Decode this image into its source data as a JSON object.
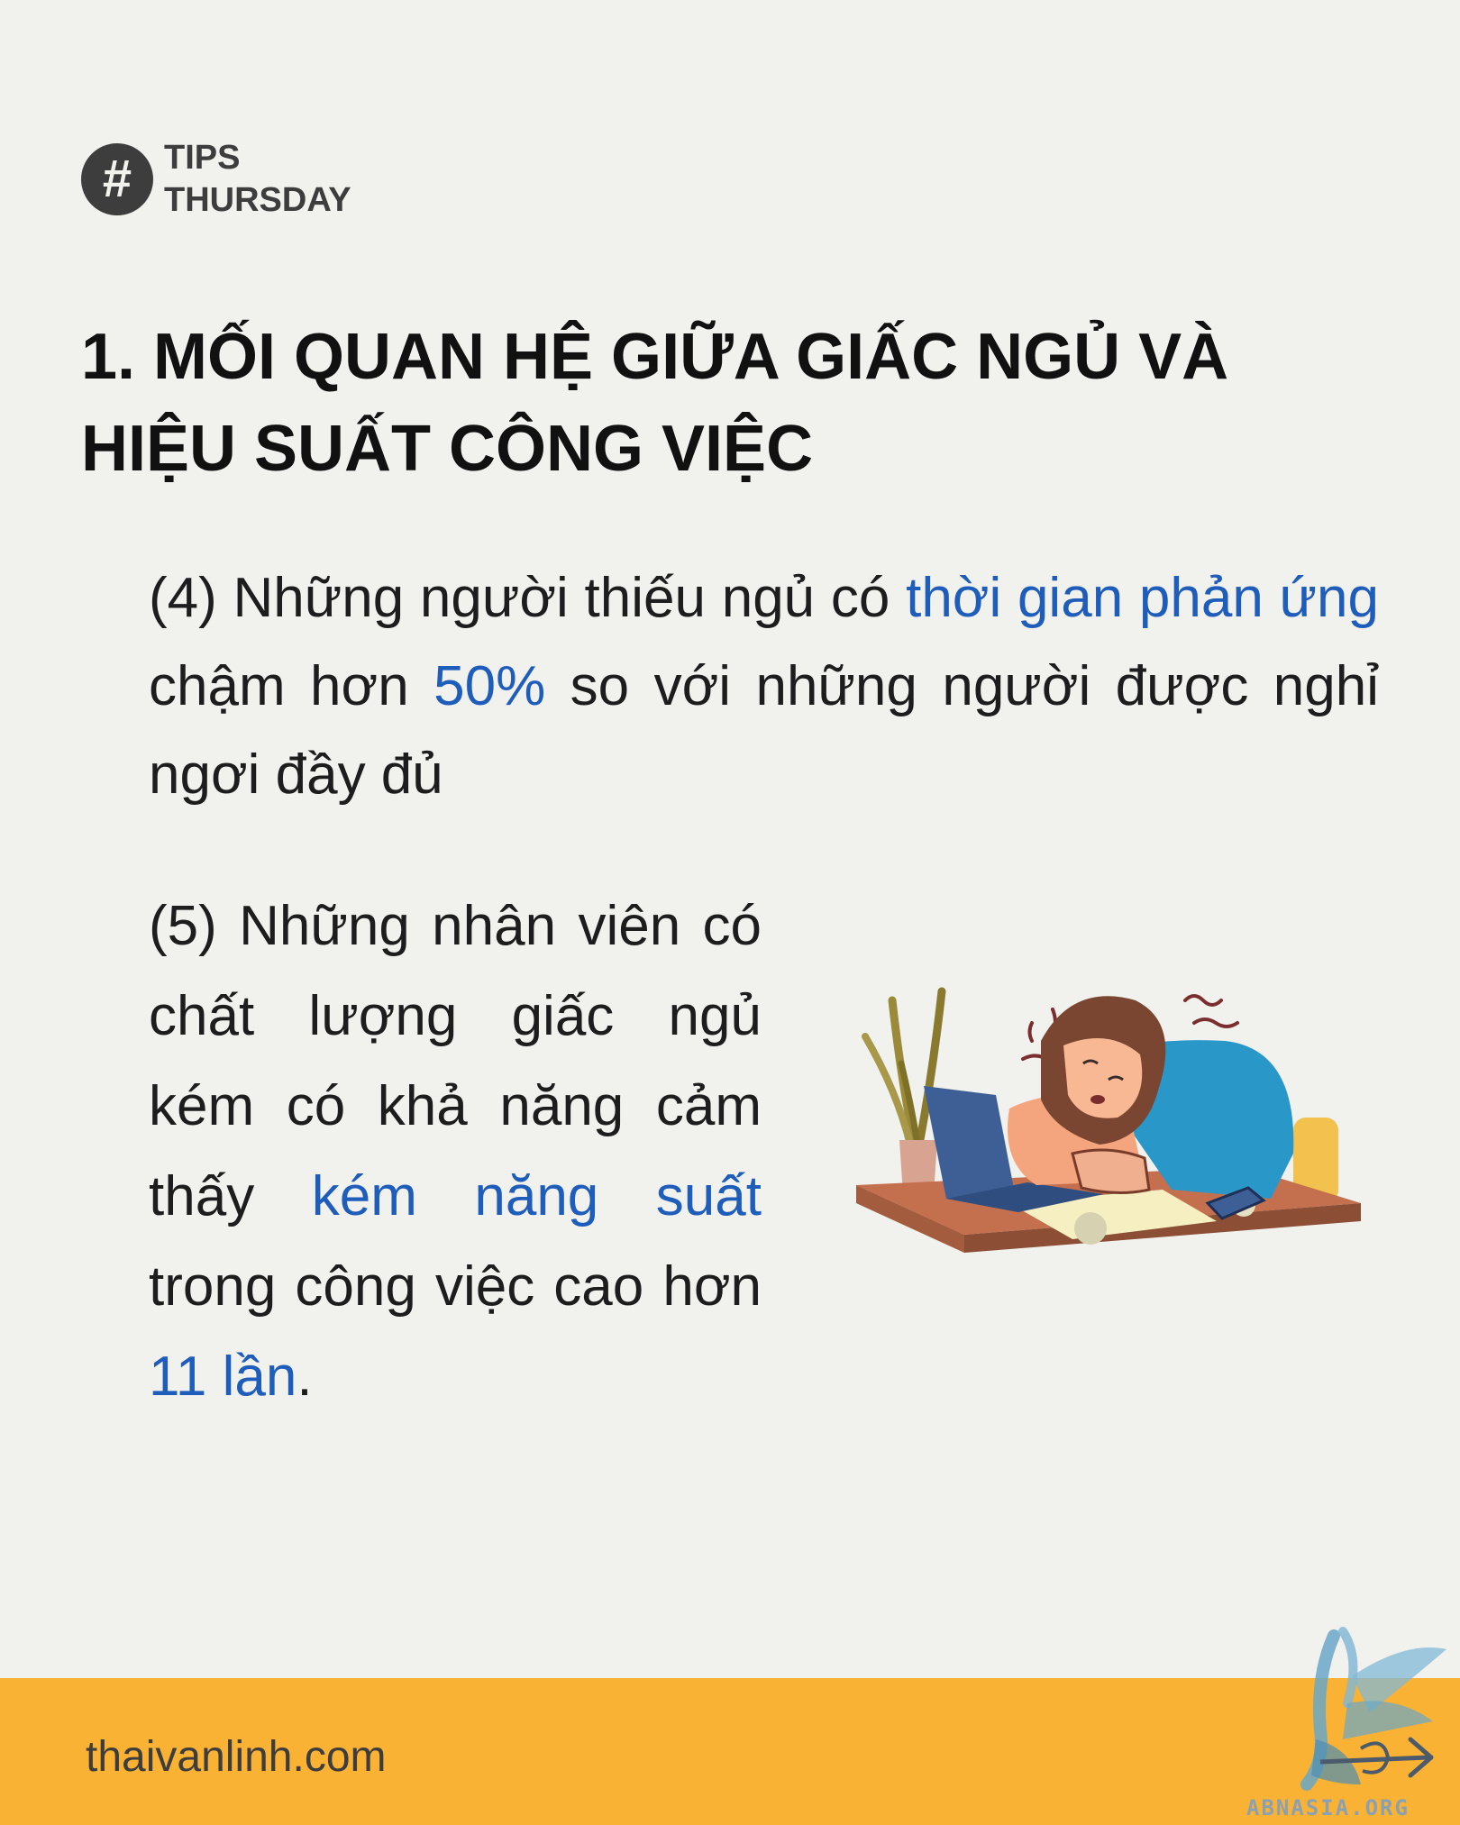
{
  "tag": {
    "symbol": "#",
    "line1": "TIPS",
    "line2": "THURSDAY"
  },
  "title": "1. MỐI QUAN HỆ GIỮA GIẤC NGỦ VÀ HIỆU SUẤT CÔNG VIỆC",
  "point4": {
    "prefix": "(4) Những người thiếu ngủ có ",
    "highlight1": "thời gian phản ứng",
    "middle": " chậm hơn ",
    "highlight2": "50%",
    "suffix": " so với những người được nghỉ ngơi đầy đủ"
  },
  "point5": {
    "prefix": "(5) Những nhân viên có chất lượng giấc ngủ kém có khả năng cảm thấy ",
    "highlight1": "kém năng suất",
    "middle": " trong công việc cao hơn ",
    "highlight2": "11 lần",
    "suffix": "."
  },
  "footer": {
    "website": "thaivanlinh.com",
    "logo_text": "ABNASIA.ORG"
  },
  "colors": {
    "background": "#f1f1ee",
    "highlight": "#1f5dbb",
    "footer": "#f9b233",
    "text": "#1d1d1d"
  }
}
